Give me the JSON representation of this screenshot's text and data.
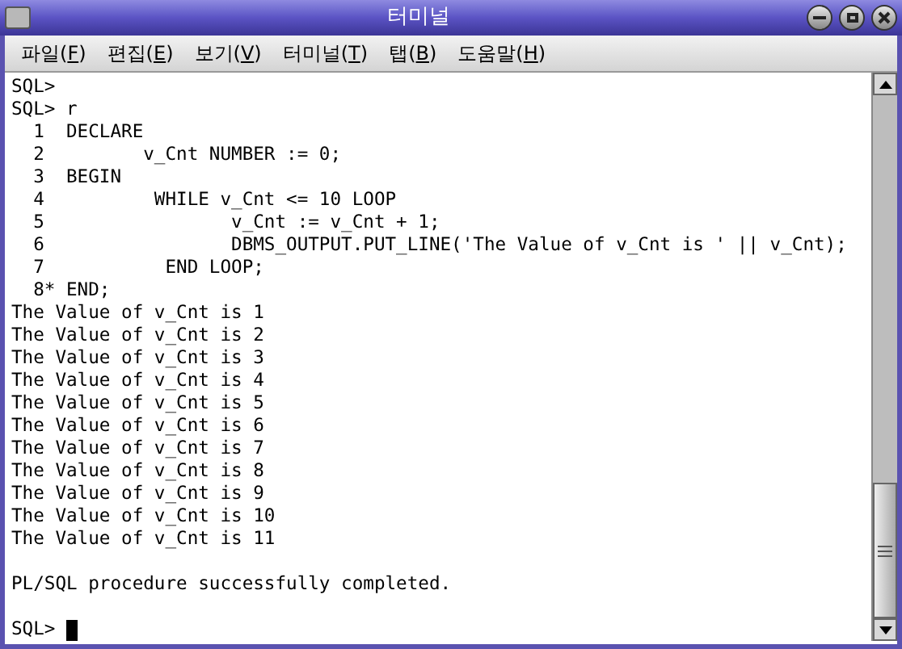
{
  "window": {
    "title": "터미널"
  },
  "menu": [
    {
      "before": "파일(",
      "key": "F",
      "after": ")"
    },
    {
      "before": "편집(",
      "key": "E",
      "after": ")"
    },
    {
      "before": "보기(",
      "key": "V",
      "after": ")"
    },
    {
      "before": "터미널(",
      "key": "T",
      "after": ")"
    },
    {
      "before": "탭(",
      "key": "B",
      "after": ")"
    },
    {
      "before": "도움말(",
      "key": "H",
      "after": ")"
    }
  ],
  "terminal": {
    "lines": [
      {
        "kind": "text",
        "text": "SQL>"
      },
      {
        "kind": "text",
        "text": "SQL> r"
      },
      {
        "kind": "text",
        "text": "  1  DECLARE"
      },
      {
        "kind": "text",
        "text": "  2         v_Cnt NUMBER := 0;"
      },
      {
        "kind": "text",
        "text": "  3  BEGIN"
      },
      {
        "kind": "text",
        "text": "  4          WHILE v_Cnt <= 10 LOOP"
      },
      {
        "kind": "text",
        "text": "  5                 v_Cnt := v_Cnt + 1;"
      },
      {
        "kind": "text",
        "text": "  6                 DBMS_OUTPUT.PUT_LINE('The Value of v_Cnt is ' || v_Cnt);"
      },
      {
        "kind": "text",
        "text": "  7           END LOOP;"
      },
      {
        "kind": "text",
        "text": "  8* END;"
      },
      {
        "kind": "text",
        "text": "The Value of v_Cnt is 1"
      },
      {
        "kind": "text",
        "text": "The Value of v_Cnt is 2"
      },
      {
        "kind": "text",
        "text": "The Value of v_Cnt is 3"
      },
      {
        "kind": "text",
        "text": "The Value of v_Cnt is 4"
      },
      {
        "kind": "text",
        "text": "The Value of v_Cnt is 5"
      },
      {
        "kind": "text",
        "text": "The Value of v_Cnt is 6"
      },
      {
        "kind": "text",
        "text": "The Value of v_Cnt is 7"
      },
      {
        "kind": "text",
        "text": "The Value of v_Cnt is 8"
      },
      {
        "kind": "text",
        "text": "The Value of v_Cnt is 9"
      },
      {
        "kind": "text",
        "text": "The Value of v_Cnt is 10"
      },
      {
        "kind": "text",
        "text": "The Value of v_Cnt is 11"
      },
      {
        "kind": "blank"
      },
      {
        "kind": "text",
        "text": "PL/SQL procedure successfully completed."
      },
      {
        "kind": "blank"
      },
      {
        "kind": "prompt",
        "text": "SQL>"
      }
    ]
  }
}
